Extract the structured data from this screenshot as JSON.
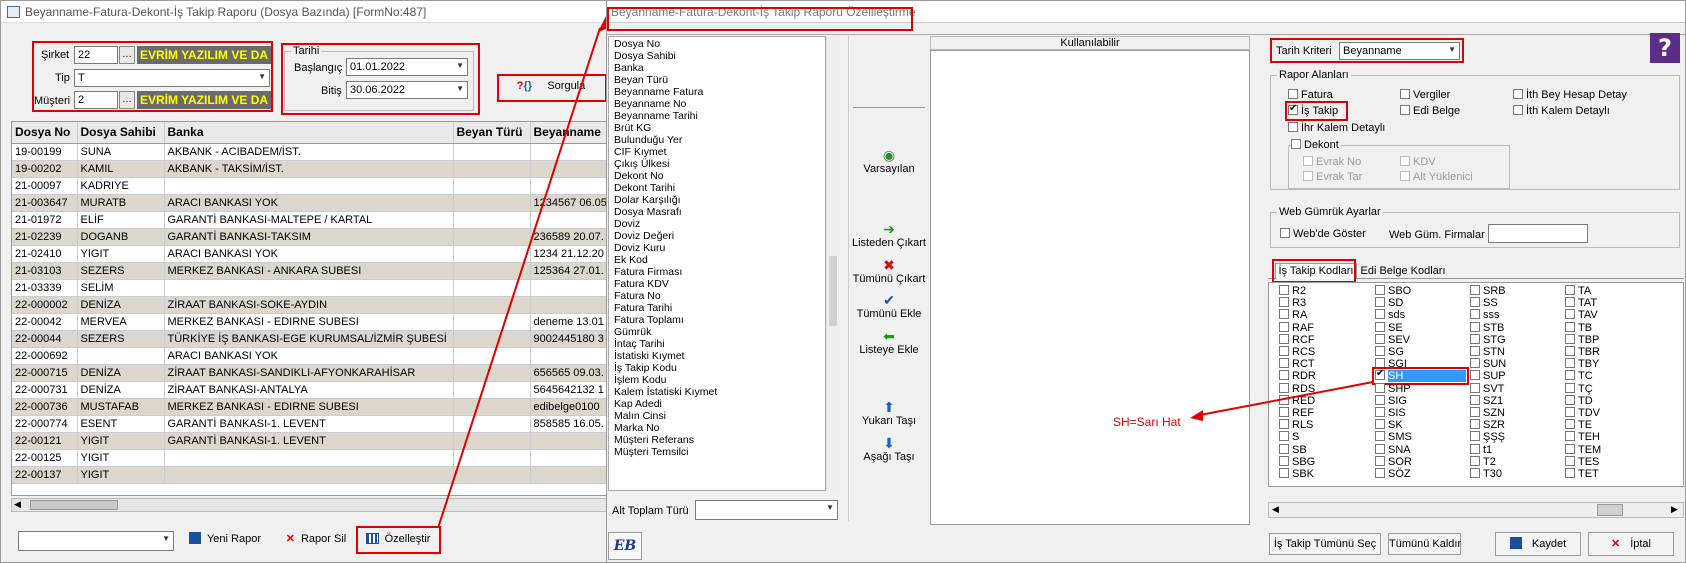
{
  "left": {
    "title": "Beyanname-Fatura-Dekont-İş Takip Raporu (Dosya Bazında) [FormNo:487]",
    "sirket_label": "Şirket",
    "sirket_value": "22",
    "sirket_name": "EVRİM YAZILIM VE DA",
    "tip_label": "Tip",
    "tip_value": "T",
    "musteri_label": "Müşteri",
    "musteri_value": "2",
    "musteri_name": "EVRİM YAZILIM VE DA",
    "tarih_label": "Tarihi",
    "baslangic_label": "Başlangıç",
    "baslangic_value": "01.01.2022",
    "bitis_label": "Bitiş",
    "bitis_value": "30.06.2022",
    "sorgula_label": "Sorgula",
    "columns": [
      "Dosya No",
      "Dosya Sahibi",
      "Banka",
      "Beyan Türü",
      "Beyanname"
    ],
    "rows": [
      [
        "19-00199",
        "SUNA",
        "AKBANK - ACIBADEM/İST.",
        "",
        ""
      ],
      [
        "19-00202",
        "KAMIL",
        "AKBANK - TAKSİM/İST.",
        "",
        ""
      ],
      [
        "21-00097",
        "KADRIYE",
        "",
        "",
        ""
      ],
      [
        "21-003647",
        "MURATB",
        "ARACI BANKASI YOK",
        "",
        "1234567 06.05"
      ],
      [
        "21-01972",
        "ELİF",
        "GARANTİ BANKASI-MALTEPE / KARTAL",
        "",
        ""
      ],
      [
        "21-02239",
        "DOGANB",
        "GARANTİ BANKASI-TAKSIM",
        "",
        "236589 20.07."
      ],
      [
        "21-02410",
        "YIGIT",
        "ARACI BANKASI YOK",
        "",
        "1234 21.12.20"
      ],
      [
        "21-03103",
        "SEZERS",
        "MERKEZ BANKASI - ANKARA SUBESI",
        "",
        "125364 27.01."
      ],
      [
        "21-03339",
        "SELİM",
        "",
        "",
        ""
      ],
      [
        "22-000002",
        "DENİZA",
        "ZİRAAT BANKASI-SOKE-AYDIN",
        "",
        ""
      ],
      [
        "22-00042",
        "MERVEA",
        "MERKEZ BANKASI - EDIRNE SUBESI",
        "",
        "deneme 13.01"
      ],
      [
        "22-00044",
        "SEZERS",
        "TÜRKİYE İŞ BANKASI-EGE KURUMSAL/İZMİR ŞUBESİ",
        "",
        "9002445180 3"
      ],
      [
        "22-000692",
        "",
        "ARACI BANKASI YOK",
        "",
        ""
      ],
      [
        "22-000715",
        "DENİZA",
        "ZİRAAT BANKASI-SANDIKLI-AFYONKARAHİSAR",
        "",
        "656565 09.03."
      ],
      [
        "22-000731",
        "DENİZA",
        "ZİRAAT BANKASI-ANTALYA",
        "",
        "5645642132 1"
      ],
      [
        "22-000736",
        "MUSTAFAB",
        "MERKEZ BANKASI - EDIRNE SUBESI",
        "",
        "edibelge0100"
      ],
      [
        "22-000774",
        "ESENT",
        "GARANTİ BANKASI-1. LEVENT",
        "",
        "858585 16.05."
      ],
      [
        "22-00121",
        "YIGIT",
        "GARANTİ BANKASI-1. LEVENT",
        "",
        ""
      ],
      [
        "22-00125",
        "YIGIT",
        "",
        "",
        ""
      ],
      [
        "22-00137",
        "YIGIT",
        "",
        "",
        ""
      ]
    ],
    "yeni_rapor": "Yeni Rapor",
    "rapor_sil": "Rapor Sil",
    "ozellestir": "Özelleştir"
  },
  "right": {
    "title": "Beyanname-Fatura-Dekont-İş Takip Raporu Özellleştirme",
    "available_fields": [
      "Dosya No",
      "Dosya Sahibi",
      "Banka",
      "Beyan Türü",
      "Beyanname Fatura",
      "Beyanname No",
      "Beyanname Tarihi",
      "Brüt KG",
      "Bulunduğu Yer",
      "CIF Kıymet",
      "Çıkış Ülkesi",
      "Dekont No",
      "Dekont Tarihi",
      "Dolar Karşılığı",
      "Dosya Masrafı",
      "Doviz",
      "Doviz Değeri",
      "Doviz Kuru",
      "Ek Kod",
      "Fatura Firması",
      "Fatura KDV",
      "Fatura No",
      "Fatura Tarihi",
      "Fatura Toplamı",
      "Gümrük",
      "İntaç Tarihi",
      "İstatiski Kıymet",
      "İş Takip Kodu",
      "İşlem Kodu",
      "Kalem İstatiski Kıymet",
      "Kap Adedi",
      "Malın Cinsi",
      "Marka No",
      "Müşteri Referans",
      "Müşteri Temsilci"
    ],
    "alt_toplam_label": "Alt Toplam Türü",
    "varsayilan": "Varsayılan",
    "listeden_cikart": "Listeden Çıkart",
    "tumunu_cikart": "Tümünü Çıkart",
    "tumunu_ekle": "Tümünü Ekle",
    "listeye_ekle": "Listeye Ekle",
    "yukari_tasi": "Yukarı Taşı",
    "asagi_tasi": "Aşağı Taşı",
    "kullanilabilir": "Kullanılabilir",
    "tarih_kriteri_label": "Tarih Kriteri",
    "tarih_kriteri_value": "Beyanname",
    "rapor_alanlari_label": "Rapor Alanları",
    "fatura": "Fatura",
    "vergiler": "Vergiler",
    "ith_bey_hesap": "İth Bey Hesap Detay",
    "is_takip": "İş Takip",
    "edi_belge": "Edi Belge",
    "ith_kalem": "İth Kalem Detaylı",
    "ihr_kalem": "İhr Kalem Detaylı",
    "dekont": "Dekont",
    "evrak_no": "Evrak No",
    "kdv": "KDV",
    "evrak_tar": "Evrak Tar",
    "alt_yuklenici": "Alt Yüklenici",
    "web_gumruk_label": "Web Gümrük Ayarlar",
    "webde_goster": "Web'de Göster",
    "web_gum_firmalar": "Web Güm. Firmalar",
    "tab_is_takip": "İş Takip Kodları",
    "tab_edi_belge": "Edi Belge Kodları",
    "kodlar": [
      [
        "R2",
        "R3",
        "RA",
        "RAF",
        "RCF",
        "RCS",
        "RCT",
        "RDR",
        "RDS",
        "RED",
        "REF",
        "RLS",
        "S",
        "SB",
        "SBG",
        "SBK"
      ],
      [
        "SBO",
        "SD",
        "sds",
        "SE",
        "SEV",
        "SG",
        "SGI",
        "SH",
        "SHP",
        "SIG",
        "SIS",
        "SK",
        "SMS",
        "SNA",
        "SOR",
        "SÖZ"
      ],
      [
        "SRB",
        "SS",
        "sss",
        "STB",
        "STG",
        "STN",
        "SUN",
        "SUP",
        "SVT",
        "SZ1",
        "SZN",
        "SZR",
        "ŞŞŞ",
        "t1",
        "T2",
        "T30"
      ],
      [
        "TA",
        "TAT",
        "TAV",
        "TB",
        "TBP",
        "TBR",
        "TBY",
        "TC",
        "TÇ",
        "TD",
        "TDV",
        "TE",
        "TEH",
        "TEM",
        "TES",
        "TET"
      ]
    ],
    "annotation": "SH=Sarı Hat",
    "is_takip_tumunu_sec": "İş Takip Tümünü Seç",
    "tumunu_kaldir": "Tümünü Kaldır",
    "kaydet": "Kaydet",
    "iptal": "İptal",
    "help_glyph": "?",
    "logo_glyph": "EB"
  },
  "colors": {
    "accent_red": "#e00000",
    "selection": "#3399ff",
    "yellow_text": "#ffff00"
  }
}
